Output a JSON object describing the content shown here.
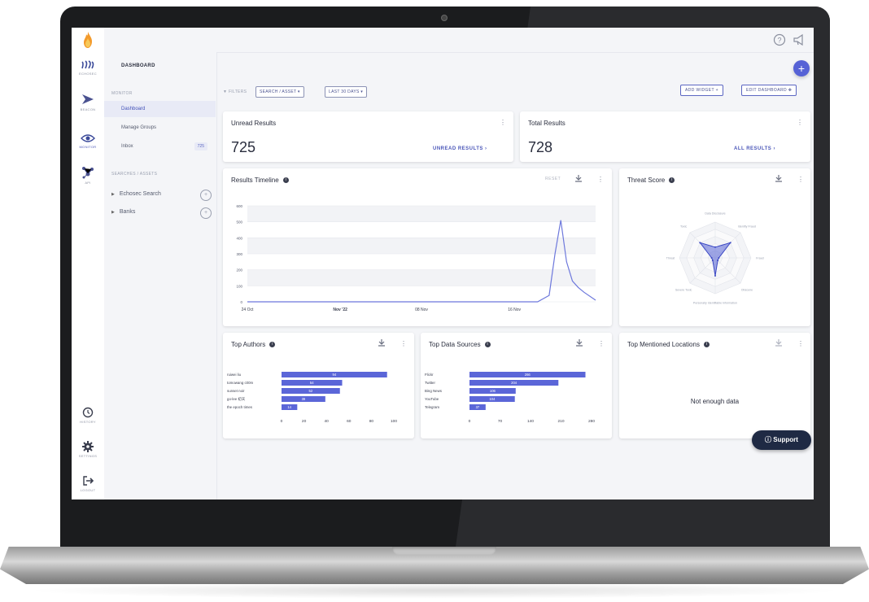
{
  "nav": {
    "items": [
      {
        "label": "ECHOSEC"
      },
      {
        "label": "BEACON"
      },
      {
        "label": "MONITOR"
      },
      {
        "label": "API"
      },
      {
        "label": "HISTORY"
      },
      {
        "label": "SETTINGS"
      },
      {
        "label": "LOGOUT"
      }
    ]
  },
  "left_panel": {
    "title": "DASHBOARD",
    "monitor_label": "MONITOR",
    "items": [
      {
        "label": "Dashboard"
      },
      {
        "label": "Manage Groups"
      },
      {
        "label": "Inbox",
        "badge": "725"
      }
    ],
    "searches_label": "SEARCHES / ASSETS",
    "tree": [
      {
        "label": "Echosec Search"
      },
      {
        "label": "Banks"
      }
    ]
  },
  "filters": {
    "label": "FILTERS",
    "search_asset": "SEARCH / ASSET",
    "date_range": "LAST 30 DAYS",
    "add_widget": "ADD WIDGET",
    "edit_dashboard": "EDIT DASHBOARD"
  },
  "cards": {
    "unread": {
      "title": "Unread Results",
      "value": "725",
      "link": "UNREAD RESULTS"
    },
    "total": {
      "title": "Total Results",
      "value": "728",
      "link": "ALL RESULTS"
    },
    "timeline": {
      "title": "Results Timeline",
      "reset": "RESET"
    },
    "threat": {
      "title": "Threat Score"
    },
    "authors": {
      "title": "Top Authors"
    },
    "sources": {
      "title": "Top Data Sources"
    },
    "locations": {
      "title": "Top Mentioned Locations",
      "empty": "Not enough data"
    }
  },
  "support": {
    "label": "Support"
  },
  "colors": {
    "accent": "#5662d6",
    "bar": "#5b66d8",
    "line": "#6d78dc"
  },
  "chart_data": [
    {
      "type": "line",
      "title": "Results Timeline",
      "x_tick_labels": [
        "24 Oct",
        "Nov '22",
        "08 Nov",
        "16 Nov"
      ],
      "y_ticks": [
        0,
        100,
        200,
        300,
        400,
        500,
        600
      ],
      "ylim": [
        0,
        600
      ],
      "x_index_range": [
        0,
        30
      ],
      "x_tick_index": [
        0,
        8,
        15,
        23
      ],
      "values_x": [
        0,
        25,
        26,
        26.5,
        27,
        27.5,
        28,
        28.5,
        29,
        30
      ],
      "values_y": [
        0,
        0,
        40,
        300,
        510,
        250,
        130,
        90,
        60,
        10
      ]
    },
    {
      "type": "radar",
      "title": "Threat Score",
      "axes": [
        "Data Disclosure",
        "Identity Fraud",
        "Fraud",
        "Obscene",
        "Personally Identifiable Information",
        "Severe Toxic",
        "Threat",
        "Toxic"
      ],
      "values": [
        0.3,
        0.6,
        0.1,
        0.1,
        0.5,
        0.1,
        0.1,
        0.6
      ],
      "rings": 5
    },
    {
      "type": "bar",
      "title": "Top Authors",
      "categories": [
        "ruiwei liu",
        "tomowang c00m",
        "sunset noir",
        "go-lee 初天",
        "the epoch times"
      ],
      "values": [
        94,
        54,
        52,
        39,
        14
      ],
      "xlim": [
        0,
        100
      ],
      "x_ticks": [
        0,
        20,
        40,
        60,
        80,
        100
      ]
    },
    {
      "type": "bar",
      "title": "Top Data Sources",
      "categories": [
        "Flickr",
        "Twitter",
        "Bing News",
        "YouTube",
        "Telegram"
      ],
      "values": [
        266,
        204,
        106,
        104,
        37
      ],
      "xlim": [
        0,
        280
      ],
      "x_ticks": [
        0,
        70,
        140,
        210,
        280
      ]
    }
  ]
}
